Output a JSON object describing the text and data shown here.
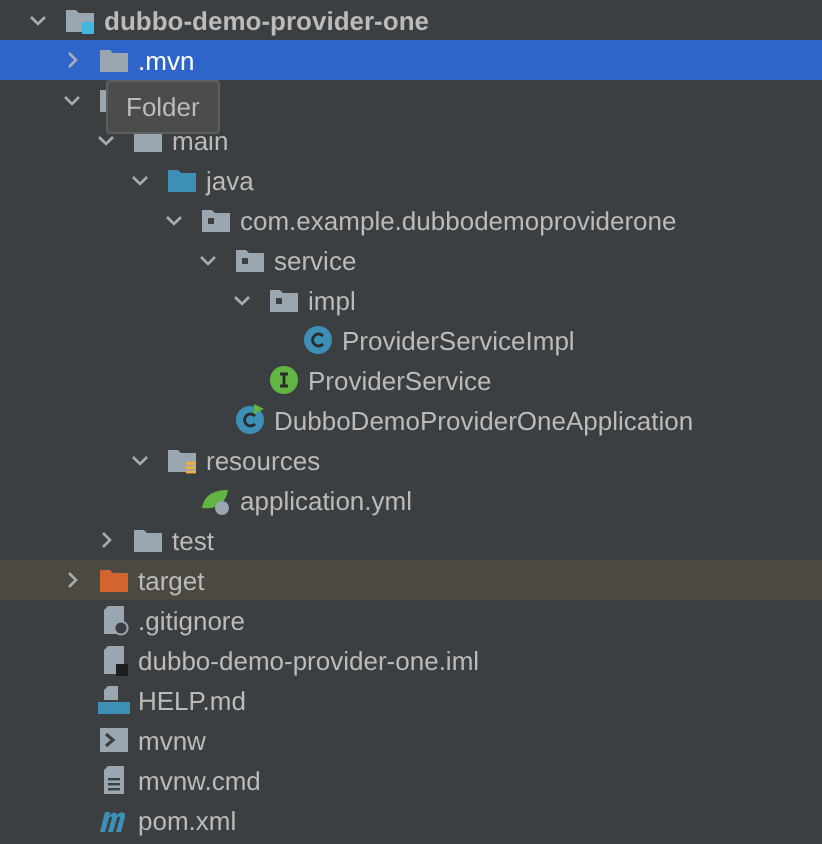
{
  "tree": [
    {
      "name": "dubbo-demo-provider-one",
      "kind": "module",
      "expanded": true,
      "selected": false,
      "highlighted": false,
      "children": [
        {
          "name": ".mvn",
          "kind": "folder",
          "expanded": false,
          "selected": true
        },
        {
          "kind": "folder",
          "expanded": true,
          "selected": false,
          "highlighted": false,
          "children": [
            {
              "name": "main",
              "kind": "folder",
              "expanded": true,
              "selected": false,
              "highlighted": false,
              "children": [
                {
                  "name": "java",
                  "kind": "source-folder",
                  "expanded": true,
                  "selected": false,
                  "highlighted": false,
                  "children": [
                    {
                      "name": "com.example.dubbodemoproviderone",
                      "kind": "package",
                      "expanded": true,
                      "selected": false,
                      "highlighted": false,
                      "children": [
                        {
                          "name": "service",
                          "kind": "package",
                          "expanded": true,
                          "selected": false,
                          "highlighted": false,
                          "children": [
                            {
                              "name": "impl",
                              "kind": "package",
                              "expanded": true,
                              "selected": false,
                              "highlighted": false,
                              "children": [
                                {
                                  "name": "ProviderServiceImpl",
                                  "kind": "class",
                                  "selected": false,
                                  "highlighted": false
                                }
                              ]
                            },
                            {
                              "name": "ProviderService",
                              "kind": "interface",
                              "selected": false,
                              "highlighted": false
                            }
                          ]
                        },
                        {
                          "name": "DubboDemoProviderOneApplication",
                          "kind": "spring-app",
                          "selected": false,
                          "highlighted": false
                        }
                      ]
                    }
                  ]
                },
                {
                  "name": "resources",
                  "kind": "resources-folder",
                  "expanded": true,
                  "selected": false,
                  "highlighted": false,
                  "children": [
                    {
                      "name": "application.yml",
                      "kind": "yml",
                      "selected": false,
                      "highlighted": false
                    }
                  ]
                }
              ]
            },
            {
              "name": "test",
              "kind": "folder",
              "expanded": false,
              "selected": false,
              "highlighted": false
            }
          ]
        },
        {
          "name": "target",
          "kind": "excluded-folder",
          "expanded": false,
          "selected": false,
          "highlighted": true
        },
        {
          "name": ".gitignore",
          "kind": "gitignore",
          "selected": false,
          "highlighted": false
        },
        {
          "name": "dubbo-demo-provider-one.iml",
          "kind": "iml",
          "selected": false,
          "highlighted": false
        },
        {
          "name": "HELP.md",
          "kind": "markdown",
          "selected": false,
          "highlighted": false
        },
        {
          "name": "mvnw",
          "kind": "script",
          "selected": false,
          "highlighted": false
        },
        {
          "name": "mvnw.cmd",
          "kind": "text",
          "selected": false,
          "highlighted": false
        },
        {
          "name": "pom.xml",
          "kind": "maven",
          "selected": false,
          "highlighted": false
        }
      ]
    }
  ],
  "tooltip": {
    "text": "Folder"
  }
}
